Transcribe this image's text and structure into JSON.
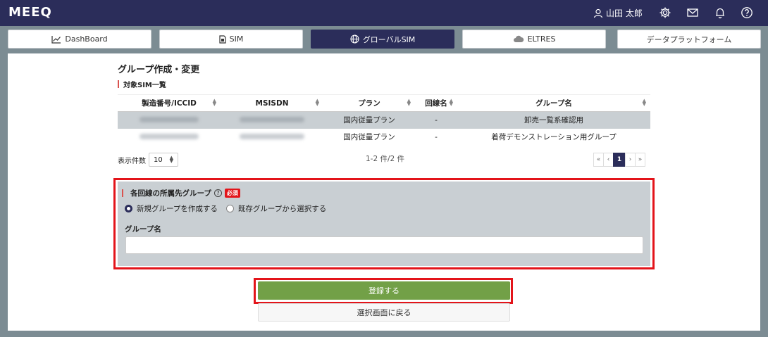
{
  "app": {
    "logo": "MEEQ",
    "user_name": "山田 太郎"
  },
  "tabs": [
    {
      "label": "DashBoard",
      "icon": "chart-line-icon"
    },
    {
      "label": "SIM",
      "icon": "sim-card-icon"
    },
    {
      "label": "グローバルSIM",
      "icon": "globe-icon"
    },
    {
      "label": "ELTRES",
      "icon": "cloud-icon"
    },
    {
      "label": "データプラットフォーム",
      "icon": ""
    }
  ],
  "page": {
    "title": "グループ作成・変更",
    "sim_list_title": "対象SIM一覧"
  },
  "table": {
    "headers": [
      "製造番号/ICCID",
      "MSISDN",
      "プラン",
      "回線名",
      "グループ名"
    ],
    "rows": [
      {
        "iccid": "",
        "msisdn": "",
        "plan": "国内従量プラン",
        "line_name": "-",
        "group": "卸売一覧系確認用"
      },
      {
        "iccid": "",
        "msisdn": "",
        "plan": "国内従量プラン",
        "line_name": "-",
        "group": "着荷デモンストレーション用グループ"
      }
    ]
  },
  "pager": {
    "page_size_label": "表示件数",
    "page_size": "10",
    "count": "1-2 件/2 件",
    "first": "«",
    "prev": "‹",
    "current": "1",
    "next": "›",
    "last": "»"
  },
  "group_form": {
    "title": "各回線の所属先グループ",
    "help": "?",
    "required": "必須",
    "radio_new": "新規グループを作成する",
    "radio_existing": "既存グループから選択する",
    "group_name_label": "グループ名",
    "group_name_value": ""
  },
  "actions": {
    "submit": "登録する",
    "back": "選択画面に戻る"
  },
  "colors": {
    "nav": "#2b2d5a",
    "submit": "#72a047",
    "highlight": "#e3141a",
    "form_bg": "#c9cfd3"
  }
}
